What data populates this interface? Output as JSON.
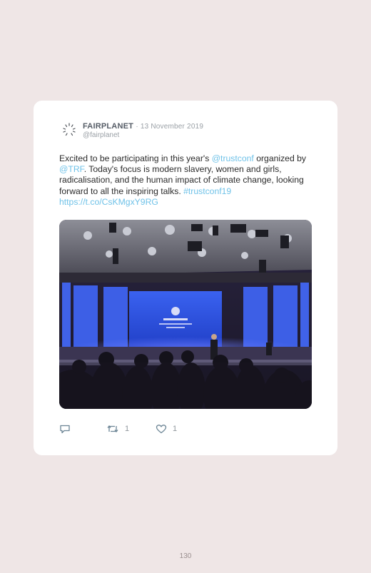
{
  "tweet": {
    "author": "FAIRPLANET",
    "date": "13 November 2019",
    "handle": "@fairplanet",
    "text_intro": "Excited to be participating in this year's ",
    "mention1": "@trustconf",
    "text_mid1": " organized by ",
    "mention2": "@TRF",
    "text_mid2": ". Today's focus is modern slavery, women and girls, radicalisation, and the human impact of climate change, looking forward to all the inspiring talks. ",
    "hashtag": "#trustconf19",
    "short_link": "https://t.co/CsKMgxY9RG",
    "retweet_count": "1",
    "like_count": "1"
  },
  "colors": {
    "link": "#6fc2e8",
    "stage_blue": "#2a4fd6",
    "background": "#efe6e6"
  },
  "icons": [
    "reply-icon",
    "retweet-icon",
    "heart-icon"
  ],
  "page_number": "130"
}
